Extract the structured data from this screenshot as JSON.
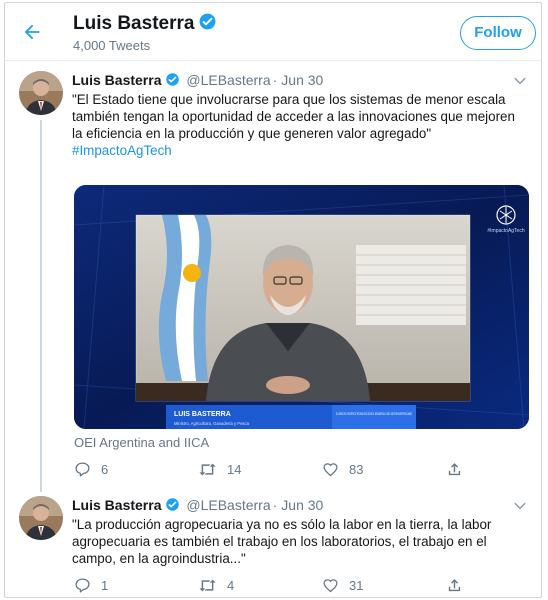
{
  "header": {
    "name": "Luis Basterra",
    "tweet_count": "4,000 Tweets",
    "follow_label": "Follow"
  },
  "tweets": [
    {
      "name": "Luis Basterra",
      "handle": "@LEBasterra",
      "date": "Jun 30",
      "text": "\"El Estado tiene que involucrarse para que los sistemas de menor escala también tengan la oportunidad de acceder a las innovaciones que mejoren la eficiencia en la producción y que generen valor agregado\"",
      "hashtag": "#ImpactoAgTech",
      "media": {
        "lower_third_name": "LUIS BASTERRA",
        "lower_third_role": "Ministro, Agricultura, Ganadería y Pesca",
        "lower_third_topic": "EL IMPACTO CIENTÍFICO TECNOLÓGICO EN EL DESARROLLO DEL SECTOR AGROPECUARIO",
        "logo_caption": "#ImpactoAgTech",
        "credit": "OEI Argentina and IICA"
      },
      "replies": "6",
      "retweets": "14",
      "likes": "83"
    },
    {
      "name": "Luis Basterra",
      "handle": "@LEBasterra",
      "date": "Jun 30",
      "text": "\"La producción agropecuaria ya no es sólo la labor en la tierra, la labor agropecuaria es también el trabajo en los laboratorios, el trabajo en el campo, en la agroindustria...\"",
      "replies": "1",
      "retweets": "4",
      "likes": "31"
    }
  ],
  "icons": {
    "back": "back-arrow-icon",
    "verified": "verified-badge-icon",
    "caret": "chevron-down-icon",
    "reply": "reply-icon",
    "retweet": "retweet-icon",
    "like": "heart-icon",
    "share": "share-icon"
  },
  "colors": {
    "accent": "#1da1f2",
    "hashtag": "#1b95e0",
    "muted": "#657786",
    "text": "#14171a"
  }
}
